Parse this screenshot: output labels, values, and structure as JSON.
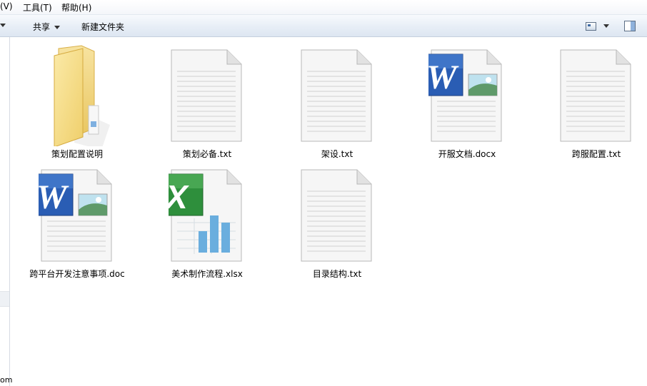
{
  "menubar": {
    "view_fragment": "(V)",
    "tools": "工具(T)",
    "help": "帮助(H)"
  },
  "toolbar": {
    "share": "共享",
    "new_folder": "新建文件夹"
  },
  "leftpane": {
    "text_fragment": "om"
  },
  "files": [
    {
      "name": "策划配置说明",
      "type": "folder"
    },
    {
      "name": "策划必备.txt",
      "type": "text"
    },
    {
      "name": "架设.txt",
      "type": "text"
    },
    {
      "name": "开服文档.docx",
      "type": "word"
    },
    {
      "name": "跨服配置.txt",
      "type": "text"
    },
    {
      "name": "跨平台开发注意事项.doc",
      "type": "word"
    },
    {
      "name": "美术制作流程.xlsx",
      "type": "excel"
    },
    {
      "name": "目录结构.txt",
      "type": "text"
    }
  ],
  "colors": {
    "word_blue": "#2a5db4",
    "excel_green": "#2e8f3c",
    "folder_yellow": "#f2d67a"
  }
}
